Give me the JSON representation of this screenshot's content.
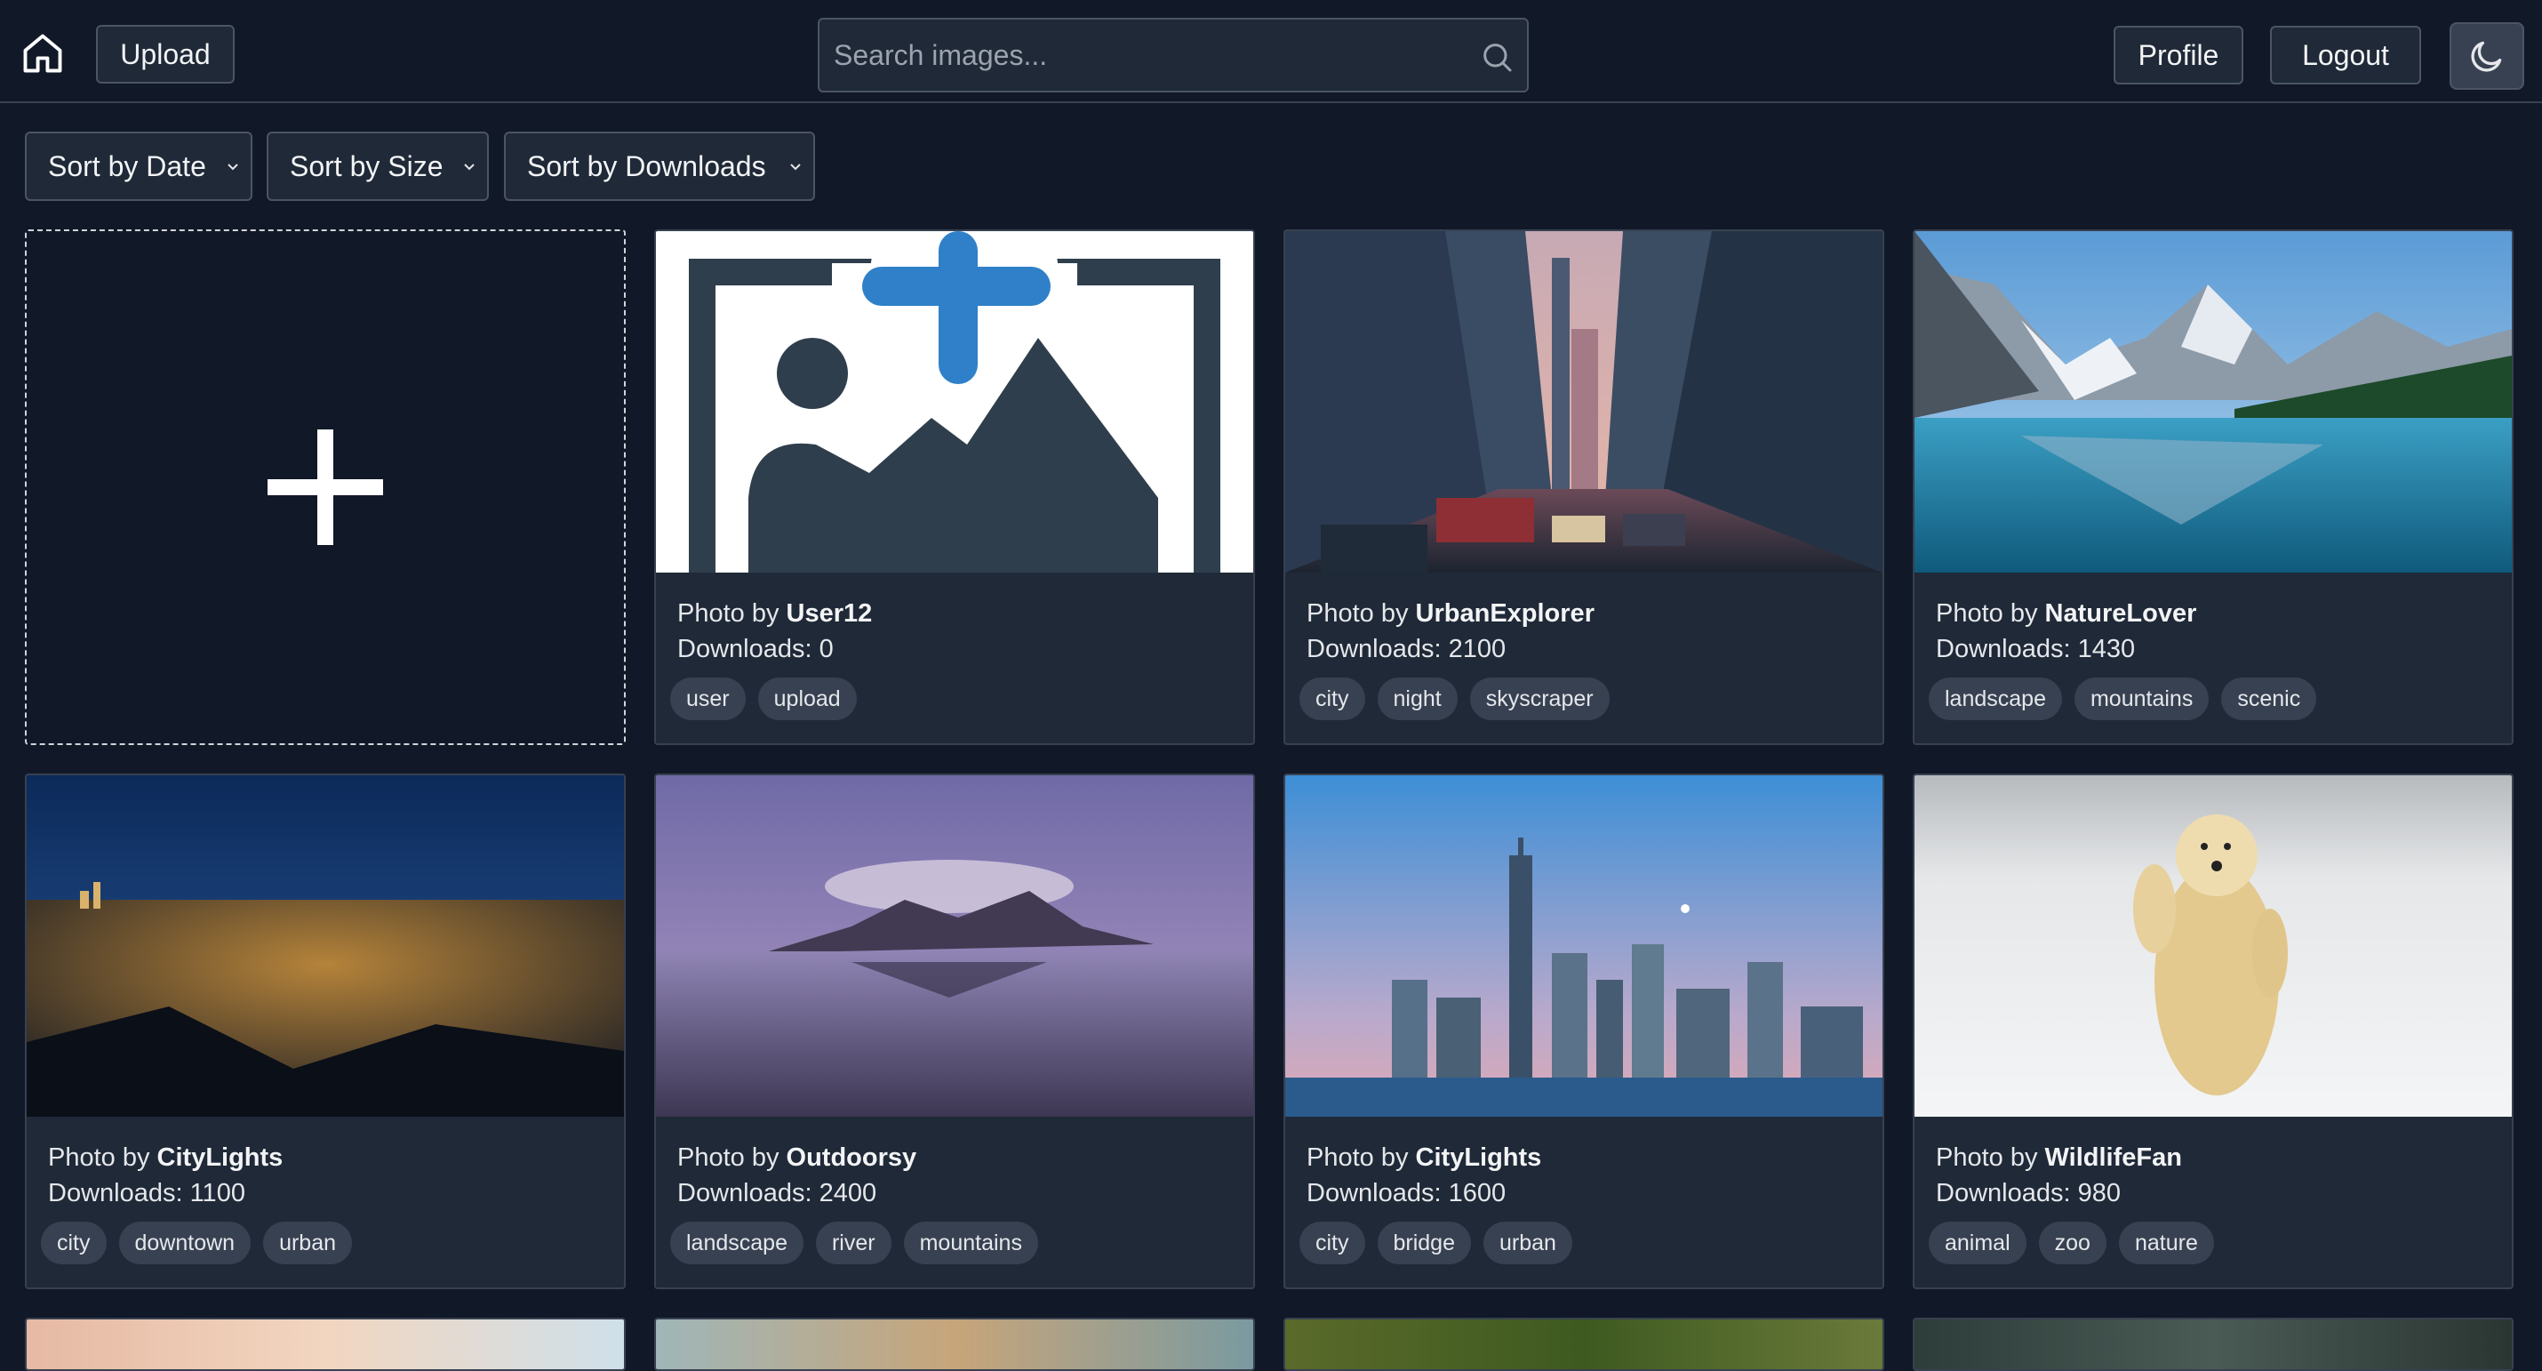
{
  "header": {
    "upload_label": "Upload",
    "search_placeholder": "Search images...",
    "profile_label": "Profile",
    "logout_label": "Logout"
  },
  "sort": {
    "date": "Sort by Date",
    "size": "Sort by Size",
    "downloads": "Sort by Downloads"
  },
  "cards": [
    {
      "by": "Photo by ",
      "author": "User12",
      "downloads": "Downloads: 0",
      "tags": [
        "user",
        "upload"
      ]
    },
    {
      "by": "Photo by ",
      "author": "UrbanExplorer",
      "downloads": "Downloads: 2100",
      "tags": [
        "city",
        "night",
        "skyscraper"
      ]
    },
    {
      "by": "Photo by ",
      "author": "NatureLover",
      "downloads": "Downloads: 1430",
      "tags": [
        "landscape",
        "mountains",
        "scenic"
      ]
    },
    {
      "by": "Photo by ",
      "author": "CityLights",
      "downloads": "Downloads: 1100",
      "tags": [
        "city",
        "downtown",
        "urban"
      ]
    },
    {
      "by": "Photo by ",
      "author": "Outdoorsy",
      "downloads": "Downloads: 2400",
      "tags": [
        "landscape",
        "river",
        "mountains"
      ]
    },
    {
      "by": "Photo by ",
      "author": "CityLights",
      "downloads": "Downloads: 1600",
      "tags": [
        "city",
        "bridge",
        "urban"
      ]
    },
    {
      "by": "Photo by ",
      "author": "WildlifeFan",
      "downloads": "Downloads: 980",
      "tags": [
        "animal",
        "zoo",
        "nature"
      ]
    }
  ]
}
